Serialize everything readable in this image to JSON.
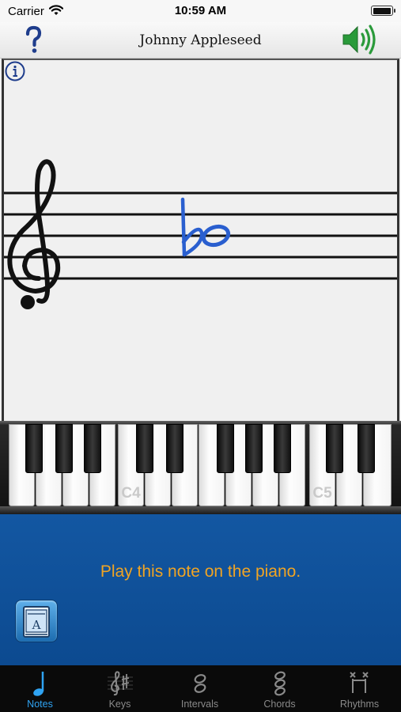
{
  "status_bar": {
    "carrier": "Carrier",
    "time": "10:59 AM",
    "battery_level": 0.9
  },
  "nav": {
    "title": "Johnny Appleseed",
    "help_icon": "question-mark-icon",
    "sound_icon": "speaker-icon"
  },
  "staff": {
    "clef": "treble",
    "note_accidental": "flat",
    "note_type": "whole",
    "info_icon": "info-icon"
  },
  "piano": {
    "labels": {
      "c4": "C4",
      "c5": "C5"
    }
  },
  "prompt": {
    "text": "Play this note on the piano.",
    "book_icon": "book-icon"
  },
  "tabs": [
    {
      "label": "Notes",
      "icon": "quarter-note-icon",
      "active": true
    },
    {
      "label": "Keys",
      "icon": "key-signature-icon",
      "active": false
    },
    {
      "label": "Intervals",
      "icon": "interval-icon",
      "active": false
    },
    {
      "label": "Chords",
      "icon": "chord-icon",
      "active": false
    },
    {
      "label": "Rhythms",
      "icon": "rhythm-icon",
      "active": false
    }
  ],
  "colors": {
    "accent": "#2fa3f2",
    "prompt_text": "#f0a423",
    "panel": "#0f4f97",
    "note": "#2a5fcf",
    "sound": "#2a9a3a"
  }
}
